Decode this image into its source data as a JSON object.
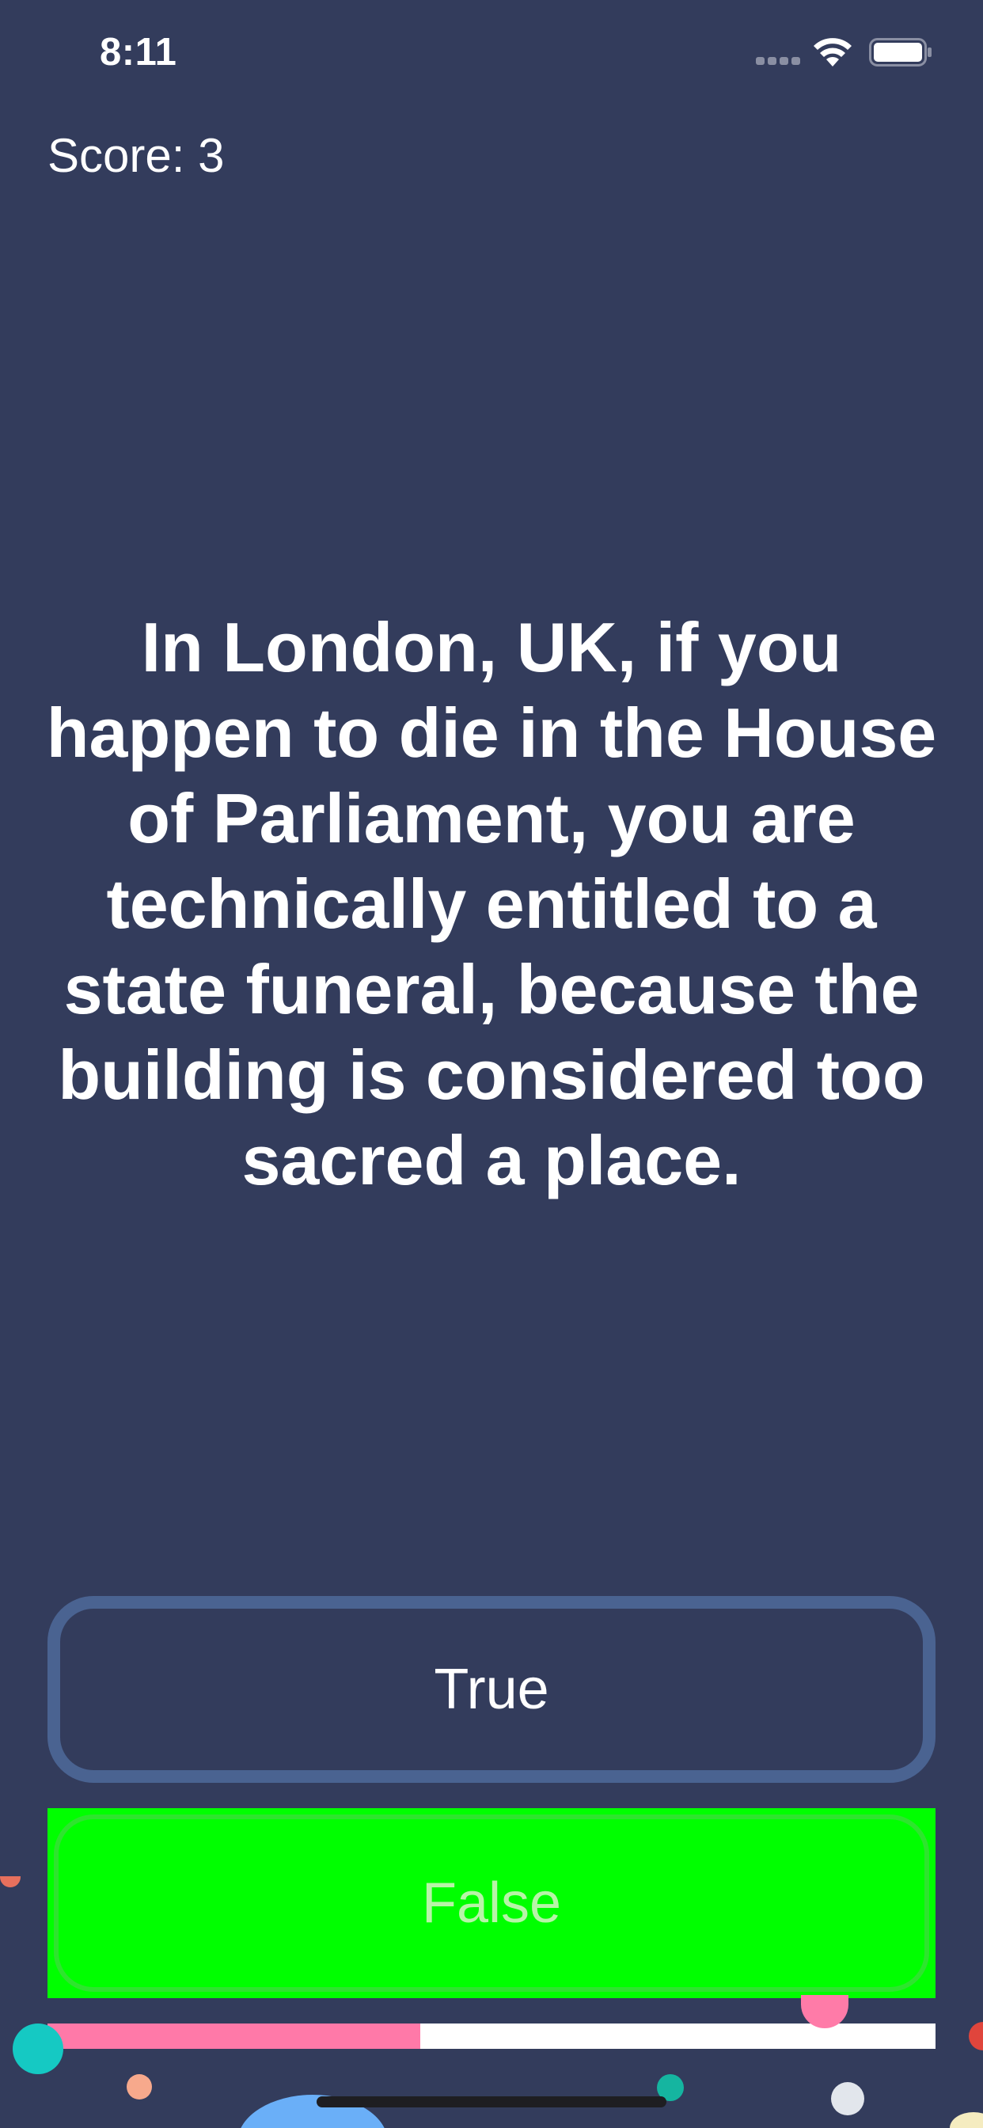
{
  "status_bar": {
    "time": "8:11",
    "wifi_icon": "wifi-icon",
    "battery_icon": "battery-icon"
  },
  "score": {
    "label": "Score: 3"
  },
  "question": {
    "text": "In London, UK, if you happen to die in the House of Parliament, you are technically entitled to a state funeral, because the building is considered too sacred a place."
  },
  "answers": {
    "true_label": "True",
    "false_label": "False"
  },
  "progress": {
    "fraction": 0.42
  },
  "colors": {
    "background": "#333c5c",
    "true_border": "#4a6391",
    "false_selected": "#00ff00",
    "progress_fill": "#ff79a8",
    "progress_track": "#ffffff"
  }
}
